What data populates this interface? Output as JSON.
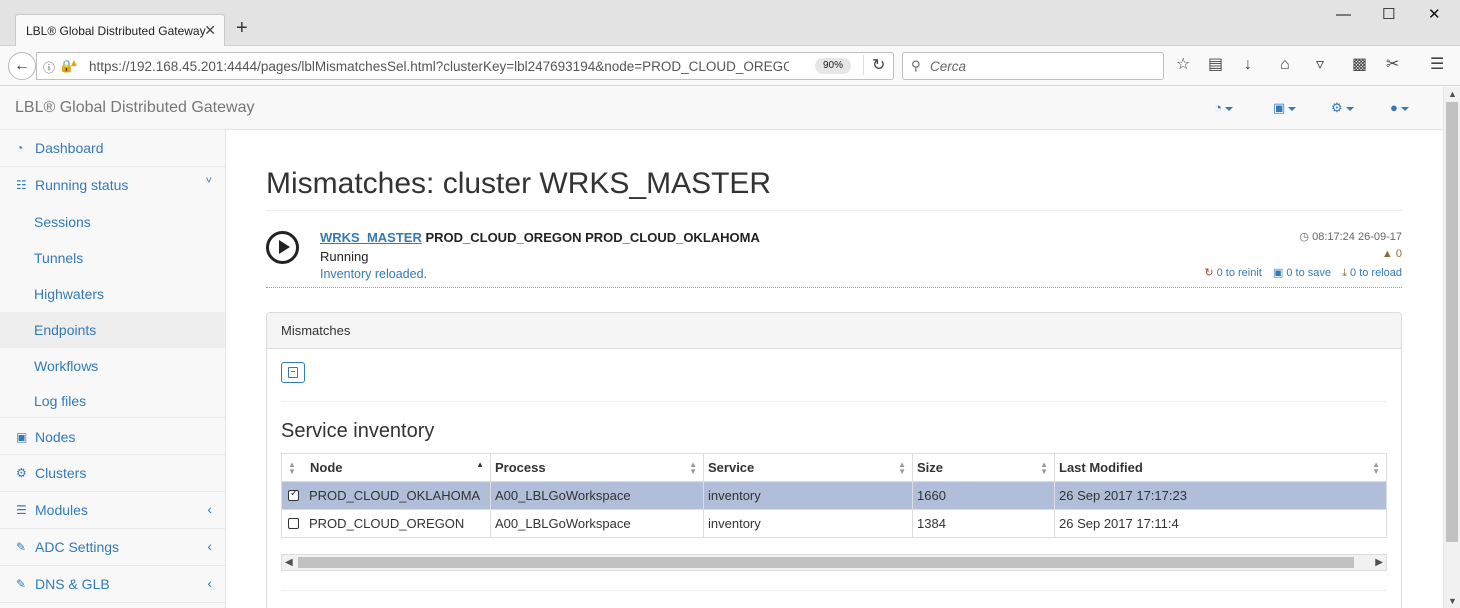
{
  "browser": {
    "tab_title": "LBL® Global Distributed Gateway",
    "tab_close": "✕",
    "new_tab": "+",
    "url": "https://192.168.45.201:4444/pages/lblMismatchesSel.html?clusterKey=lbl247693194&node=PROD_CLOUD_OREGO",
    "zoom": "90%",
    "search_placeholder": "Cerca",
    "window_controls": [
      "—",
      "☐",
      "✕"
    ]
  },
  "app": {
    "brand": "LBL® Global Distributed Gateway",
    "header_menus": [
      {
        "icon": "dashboard-icon",
        "glyph": "◔"
      },
      {
        "icon": "save-icon",
        "glyph": "▣"
      },
      {
        "icon": "settings-icon",
        "glyph": "⚙"
      },
      {
        "icon": "user-icon",
        "glyph": "●"
      }
    ]
  },
  "sidebar": {
    "items": [
      {
        "label": "Dashboard",
        "icon": "dashboard-icon",
        "glyph": "◔"
      },
      {
        "label": "Running status",
        "icon": "bar-chart-icon",
        "glyph": "☷",
        "arrow": "˅"
      },
      {
        "label": "Nodes",
        "icon": "cube-icon",
        "glyph": "▣"
      },
      {
        "label": "Clusters",
        "icon": "cogs-icon",
        "glyph": "⚙"
      },
      {
        "label": "Modules",
        "icon": "list-icon",
        "glyph": "☰",
        "arrow": "‹"
      },
      {
        "label": "ADC Settings",
        "icon": "edit-icon",
        "glyph": "✎",
        "arrow": "‹"
      },
      {
        "label": "DNS & GLB",
        "icon": "edit-icon",
        "glyph": "✎",
        "arrow": "‹"
      }
    ],
    "sub_items": [
      "Sessions",
      "Tunnels",
      "Highwaters",
      "Endpoints",
      "Workflows",
      "Log files"
    ],
    "active_sub": "Endpoints"
  },
  "main": {
    "title": "Mismatches: cluster WRKS_MASTER",
    "cluster": {
      "link": "WRKS_MASTER",
      "nodes": " PROD_CLOUD_OREGON PROD_CLOUD_OKLAHOMA",
      "status": "Running",
      "message": "Inventory reloaded.",
      "timestamp": "08:17:24 26-09-17",
      "warnings": "0",
      "reinit": "0 to reinit",
      "save": "0 to save",
      "reload": "0 to reload"
    },
    "panel_title": "Mismatches",
    "section_title": "Service inventory",
    "table": {
      "columns": [
        "Node",
        "Process",
        "Service",
        "Size",
        "Last Modified"
      ],
      "rows": [
        {
          "node": "PROD_CLOUD_OKLAHOMA",
          "process": "A00_LBLGoWorkspace",
          "service": "inventory",
          "size": "1660",
          "modified": "26 Sep 2017 17:17:23",
          "checked": true
        },
        {
          "node": "PROD_CLOUD_OREGON",
          "process": "A00_LBLGoWorkspace",
          "service": "inventory",
          "size": "1384",
          "modified": "26 Sep 2017 17:11:4",
          "checked": false
        }
      ]
    }
  },
  "colors": {
    "link": "#337ab7",
    "selected_row": "#b0bed9",
    "warning": "#8a6d3b",
    "reinit": "#a94442"
  }
}
